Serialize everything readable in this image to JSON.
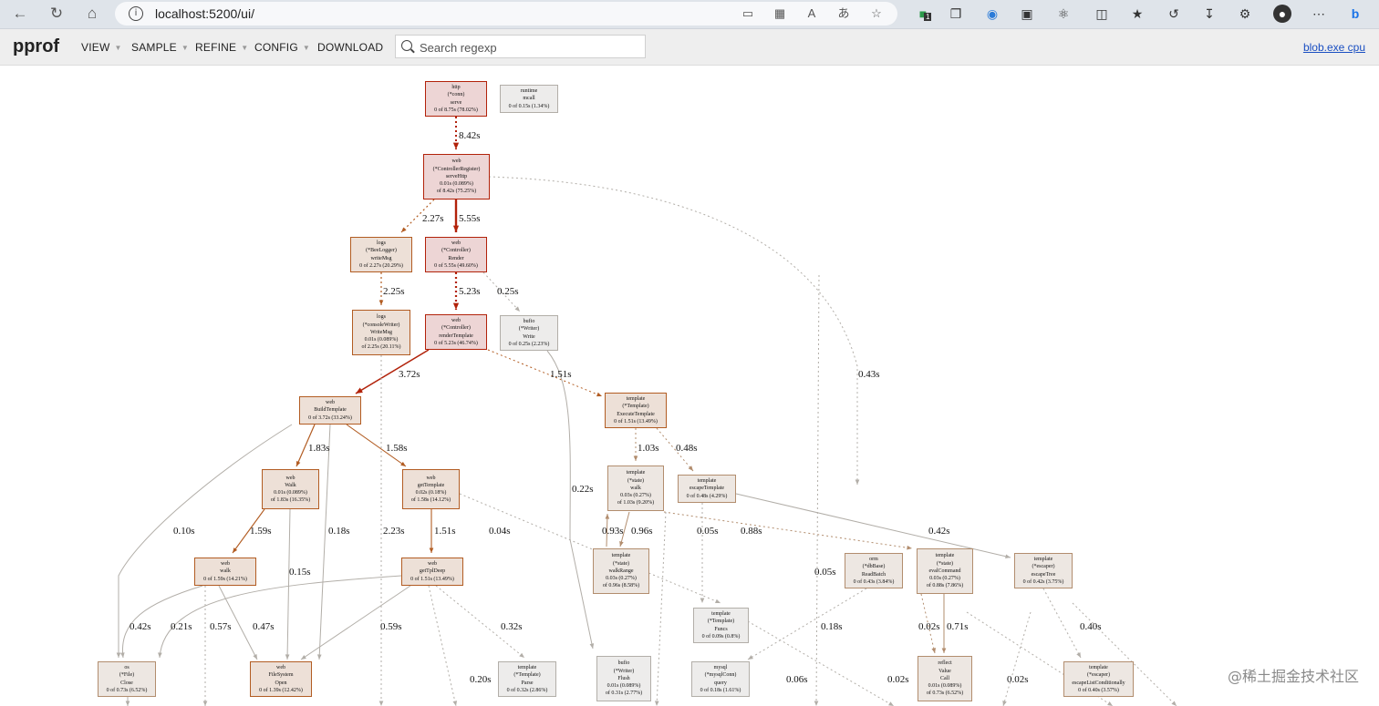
{
  "browser": {
    "url": "localhost:5200/ui/",
    "extension_badge": "1"
  },
  "header": {
    "logo": "pprof",
    "menu": [
      "VIEW",
      "SAMPLE",
      "REFINE",
      "CONFIG",
      "DOWNLOAD"
    ],
    "search_placeholder": "Search regexp",
    "profile_link": "blob.exe cpu"
  },
  "graph": {
    "nodes": [
      {
        "id": "n1",
        "lines": [
          "http",
          "(*conn)",
          "serve",
          "0 of 8.75s (78.02%)"
        ],
        "level": "hot"
      },
      {
        "id": "n2",
        "lines": [
          "runtime",
          "mcall",
          "0 of 0.15s (1.34%)"
        ],
        "level": "cold"
      },
      {
        "id": "n3",
        "lines": [
          "web",
          "(*ControllerRegister)",
          "serveHttp",
          "0.01s (0.089%)",
          "of 8.42s (75.25%)"
        ],
        "level": "hot"
      },
      {
        "id": "n4",
        "lines": [
          "logs",
          "(*BeeLogger)",
          "writeMsg",
          "0 of 2.27s (20.29%)"
        ],
        "level": "warm"
      },
      {
        "id": "n5",
        "lines": [
          "web",
          "(*Controller)",
          "Render",
          "0 of 5.55s (49.60%)"
        ],
        "level": "hot"
      },
      {
        "id": "n6",
        "lines": [
          "logs",
          "(*consoleWriter)",
          "WriteMsg",
          "0.01s (0.089%)",
          "of 2.25s (20.11%)"
        ],
        "level": "warm"
      },
      {
        "id": "n7",
        "lines": [
          "web",
          "(*Controller)",
          "renderTemplate",
          "0 of 5.23s (46.74%)"
        ],
        "level": "hot"
      },
      {
        "id": "n8",
        "lines": [
          "bufio",
          "(*Writer)",
          "Write",
          "0 of 0.25s (2.23%)"
        ],
        "level": "cold"
      },
      {
        "id": "n9",
        "lines": [
          "web",
          "BuildTemplate",
          "0 of 3.72s (33.24%)"
        ],
        "level": "warm"
      },
      {
        "id": "n10",
        "lines": [
          "template",
          "(*Template)",
          "ExecuteTemplate",
          "0 of 1.51s (13.49%)"
        ],
        "level": "warm"
      },
      {
        "id": "n11",
        "lines": [
          "web",
          "Walk",
          "0.01s (0.089%)",
          "of 1.83s (16.35%)"
        ],
        "level": "warm"
      },
      {
        "id": "n12",
        "lines": [
          "web",
          "getTemplate",
          "0.02s (0.18%)",
          "of 1.58s (14.12%)"
        ],
        "level": "warm"
      },
      {
        "id": "n13",
        "lines": [
          "template",
          "(*state)",
          "walk",
          "0.03s (0.27%)",
          "of 1.03s (9.20%)"
        ],
        "level": "mild"
      },
      {
        "id": "n14",
        "lines": [
          "template",
          "escapeTemplate",
          "0 of 0.48s (4.29%)"
        ],
        "level": "mild"
      },
      {
        "id": "n15",
        "lines": [
          "web",
          "walk",
          "0 of 1.59s (14.21%)"
        ],
        "level": "warm"
      },
      {
        "id": "n16",
        "lines": [
          "web",
          "getTplDeep",
          "0 of 1.51s (13.49%)"
        ],
        "level": "warm"
      },
      {
        "id": "n17",
        "lines": [
          "template",
          "(*state)",
          "walkRange",
          "0.03s (0.27%)",
          "of 0.96s (8.58%)"
        ],
        "level": "mild"
      },
      {
        "id": "n18",
        "lines": [
          "orm",
          "(*dbBase)",
          "ReadBatch",
          "0 of 0.43s (3.84%)"
        ],
        "level": "mild"
      },
      {
        "id": "n19",
        "lines": [
          "template",
          "(*state)",
          "evalCommand",
          "0.03s (0.27%)",
          "of 0.88s (7.86%)"
        ],
        "level": "mild"
      },
      {
        "id": "n20",
        "lines": [
          "template",
          "(*escaper)",
          "escapeTree",
          "0 of 0.42s (3.75%)"
        ],
        "level": "mild"
      },
      {
        "id": "n21",
        "lines": [
          "template",
          "(*Template)",
          "Funcs",
          "0 of 0.09s (0.8%)"
        ],
        "level": "cold"
      },
      {
        "id": "n22",
        "lines": [
          "os",
          "(*File)",
          "Close",
          "0 of 0.73s (6.52%)"
        ],
        "level": "mild"
      },
      {
        "id": "n23",
        "lines": [
          "web",
          "FileSystem",
          "Open",
          "0 of 1.39s (12.42%)"
        ],
        "level": "warm"
      },
      {
        "id": "n24",
        "lines": [
          "template",
          "(*Template)",
          "Parse",
          "0 of 0.32s (2.86%)"
        ],
        "level": "cold"
      },
      {
        "id": "n25",
        "lines": [
          "bufio",
          "(*Writer)",
          "Flush",
          "0.01s (0.089%)",
          "of 0.31s (2.77%)"
        ],
        "level": "cold"
      },
      {
        "id": "n26",
        "lines": [
          "mysql",
          "(*mysqlConn)",
          "query",
          "0 of 0.18s (1.61%)"
        ],
        "level": "cold"
      },
      {
        "id": "n27",
        "lines": [
          "reflect",
          "Value",
          "Call",
          "0.01s (0.089%)",
          "of 0.73s (6.52%)"
        ],
        "level": "mild"
      },
      {
        "id": "n28",
        "lines": [
          "template",
          "(*escaper)",
          "escapeListConditionally",
          "0 of 0.40s (3.57%)"
        ],
        "level": "mild"
      }
    ],
    "edge_labels": [
      "8.42s",
      "2.27s",
      "5.55s",
      "2.25s",
      "5.23s",
      "0.25s",
      "3.72s",
      "1.51s",
      "0.43s",
      "1.83s",
      "1.58s",
      "1.03s",
      "0.48s",
      "0.22s",
      "0.10s",
      "1.59s",
      "0.18s",
      "2.23s",
      "1.51s",
      "0.04s",
      "0.93s",
      "0.96s",
      "0.05s",
      "0.88s",
      "0.42s",
      "0.15s",
      "0.05s",
      "0.42s",
      "0.21s",
      "0.57s",
      "0.47s",
      "0.59s",
      "0.32s",
      "0.18s",
      "0.02s",
      "0.71s",
      "0.40s",
      "0.20s",
      "0.06s",
      "0.02s",
      "0.02s"
    ],
    "colors": {
      "hot_fill": "#edd5d5",
      "hot_border": "#b2220a",
      "warm_fill": "#ede0d7",
      "warm_border": "#b25c22",
      "mild_fill": "#ede7e2",
      "mild_border": "#b28d6e",
      "cold_fill": "#edeceb",
      "cold_border": "#b2aea8"
    }
  },
  "watermark": "@稀土掘金技术社区"
}
